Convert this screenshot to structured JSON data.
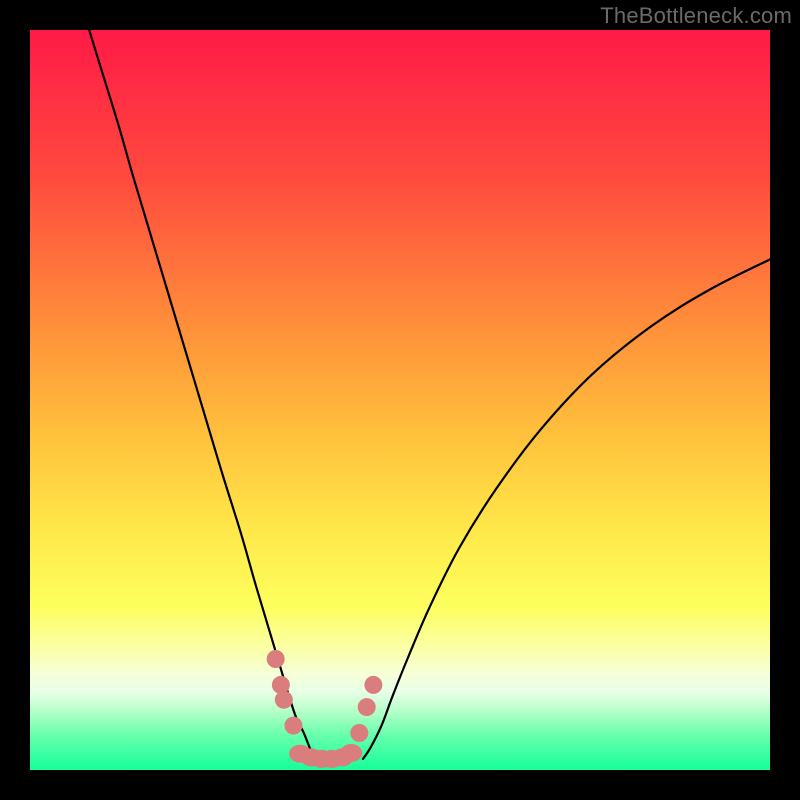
{
  "watermark": "TheBottleneck.com",
  "chart_data": {
    "type": "line",
    "title": "",
    "xlabel": "",
    "ylabel": "",
    "xlim": [
      0,
      100
    ],
    "ylim": [
      0,
      100
    ],
    "legend": false,
    "grid": false,
    "background": {
      "kind": "vertical-gradient",
      "stops": [
        {
          "pos": 0.0,
          "color": "#ff1a47"
        },
        {
          "pos": 0.2,
          "color": "#ff4a3e"
        },
        {
          "pos": 0.4,
          "color": "#ff8f3a"
        },
        {
          "pos": 0.55,
          "color": "#ffc23c"
        },
        {
          "pos": 0.68,
          "color": "#ffe94a"
        },
        {
          "pos": 0.78,
          "color": "#fdff5e"
        },
        {
          "pos": 0.835,
          "color": "#fbffa6"
        },
        {
          "pos": 0.87,
          "color": "#f6ffd8"
        },
        {
          "pos": 0.895,
          "color": "#e7ffe8"
        },
        {
          "pos": 0.92,
          "color": "#b7ffc9"
        },
        {
          "pos": 0.95,
          "color": "#6dffae"
        },
        {
          "pos": 1.0,
          "color": "#16ff99"
        }
      ]
    },
    "series": [
      {
        "name": "left-curve",
        "color": "#000000",
        "x": [
          8.0,
          10.0,
          12.0,
          14.0,
          17.0,
          20.0,
          23.0,
          26.0,
          28.5,
          30.5,
          32.3,
          33.8,
          35.0,
          36.0,
          37.0,
          37.8,
          38.5
        ],
        "y": [
          100.0,
          93.5,
          87.0,
          80.0,
          70.0,
          60.0,
          50.0,
          40.0,
          32.0,
          25.0,
          19.0,
          14.0,
          10.0,
          7.0,
          5.0,
          3.0,
          1.5
        ]
      },
      {
        "name": "right-curve",
        "color": "#000000",
        "x": [
          45.0,
          46.0,
          47.5,
          49.0,
          51.0,
          54.0,
          58.0,
          63.0,
          69.0,
          76.0,
          84.0,
          92.0,
          100.0
        ],
        "y": [
          1.5,
          3.0,
          6.0,
          10.0,
          15.0,
          22.0,
          30.0,
          38.0,
          46.0,
          53.5,
          60.0,
          65.0,
          69.0
        ]
      },
      {
        "name": "left-dots",
        "color": "#d97d7d",
        "x": [
          33.2,
          33.9,
          34.3,
          35.6
        ],
        "y": [
          15.0,
          11.5,
          9.5,
          6.0
        ]
      },
      {
        "name": "right-dots",
        "color": "#d97d7d",
        "x": [
          44.5,
          45.5,
          46.4
        ],
        "y": [
          5.0,
          8.5,
          11.5
        ]
      },
      {
        "name": "bridge-blobs",
        "color": "#d97d7d",
        "x": [
          36.5,
          38.0,
          39.4,
          40.8,
          42.2,
          43.4
        ],
        "y": [
          2.2,
          1.7,
          1.5,
          1.5,
          1.7,
          2.3
        ]
      }
    ]
  }
}
